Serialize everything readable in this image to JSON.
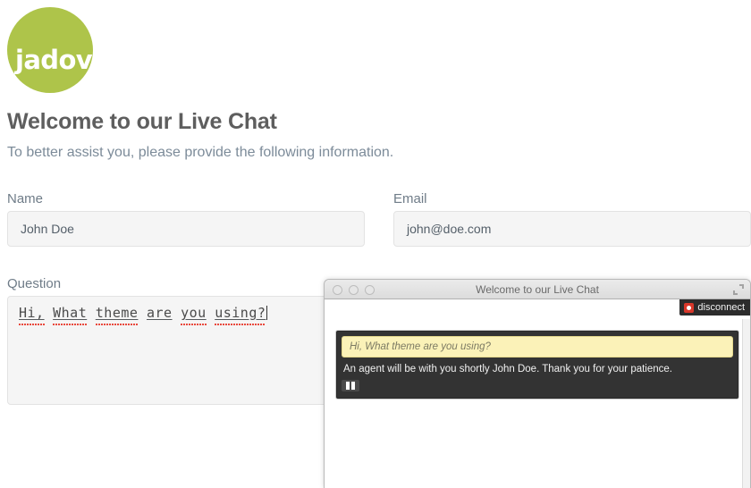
{
  "brand": {
    "logo_text": "jadove",
    "logo_color": "#aec44a"
  },
  "page": {
    "title": "Welcome to our Live Chat",
    "subtitle": "To better assist you, please provide the following information."
  },
  "form": {
    "name": {
      "label": "Name",
      "value": "John Doe",
      "placeholder": "Name"
    },
    "email": {
      "label": "Email",
      "value": "john@doe.com",
      "placeholder": "Email"
    },
    "question": {
      "label": "Question",
      "value": "Hi, What theme are you using?",
      "placeholder": "Question",
      "tokens": [
        {
          "text": "Hi,",
          "misspelled": true
        },
        {
          "text": "What",
          "misspelled": true
        },
        {
          "text": "theme",
          "misspelled": true
        },
        {
          "text": "are",
          "misspelled": false
        },
        {
          "text": "you",
          "misspelled": true
        },
        {
          "text": "using?",
          "misspelled": true
        }
      ]
    }
  },
  "chat_window": {
    "title": "Welcome to our Live Chat",
    "disconnect_label": "disconnect",
    "messages": [
      {
        "author": "user",
        "text": "Hi, What theme are you using?"
      },
      {
        "author": "system",
        "text": "An agent will be with you shortly John Doe. Thank you for your patience."
      }
    ]
  }
}
